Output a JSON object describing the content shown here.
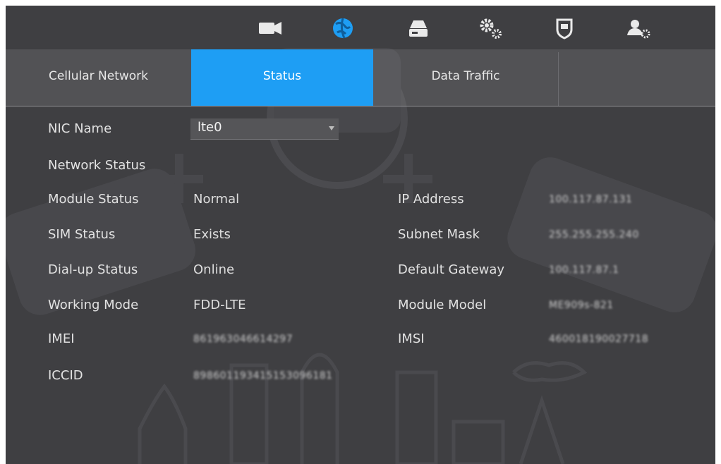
{
  "nav_icons": [
    {
      "name": "camera-icon"
    },
    {
      "name": "network-icon"
    },
    {
      "name": "storage-icon"
    },
    {
      "name": "system-settings-icon"
    },
    {
      "name": "security-shield-icon"
    },
    {
      "name": "account-settings-icon"
    }
  ],
  "accent_color": "#1e9ef4",
  "tabs": [
    {
      "label": "Cellular Network",
      "active": false
    },
    {
      "label": "Status",
      "active": true
    },
    {
      "label": "Data Traffic",
      "active": false
    }
  ],
  "nic_name": {
    "label": "NIC Name",
    "value": "lte0"
  },
  "network_status_heading": "Network Status",
  "left_fields": [
    {
      "label": "Module Status",
      "value": "Normal"
    },
    {
      "label": "SIM Status",
      "value": "Exists"
    },
    {
      "label": "Dial-up Status",
      "value": "Online"
    },
    {
      "label": "Working Mode",
      "value": "FDD-LTE"
    },
    {
      "label": "IMEI",
      "value": "861963046614297"
    },
    {
      "label": "ICCID",
      "value": "898601193415153096181"
    }
  ],
  "right_fields": [
    {
      "label": "IP Address",
      "value": "100.117.87.131"
    },
    {
      "label": "Subnet Mask",
      "value": "255.255.255.240"
    },
    {
      "label": "Default Gateway",
      "value": "100.117.87.1"
    },
    {
      "label": "Module Model",
      "value": "ME909s-821"
    },
    {
      "label": "IMSI",
      "value": "460018190027718"
    }
  ]
}
